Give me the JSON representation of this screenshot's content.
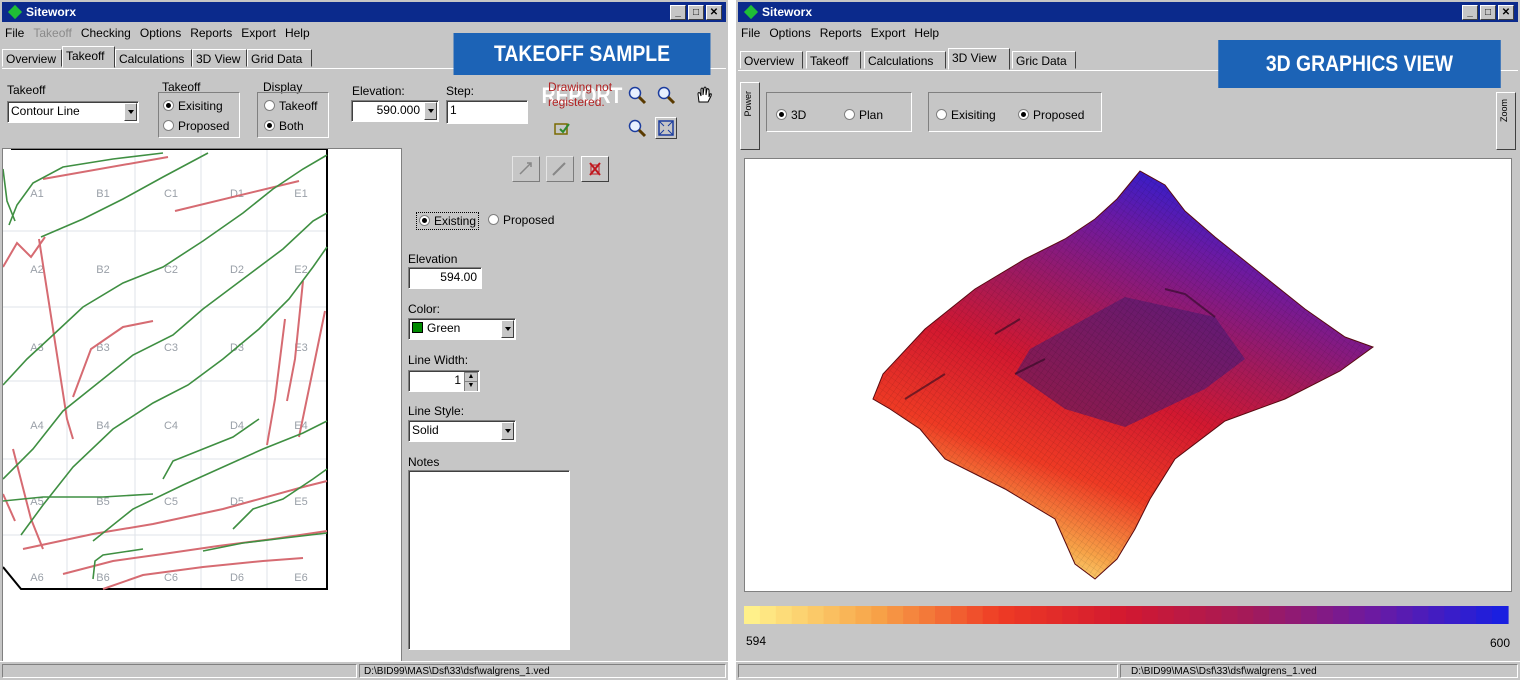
{
  "left_window": {
    "title": "Siteworx",
    "menu": [
      "File",
      "Takeoff",
      "Checking",
      "Options",
      "Reports",
      "Export",
      "Help"
    ],
    "tabs": [
      "Overview",
      "Takeoff",
      "Calculations",
      "3D View",
      "Grid Data"
    ],
    "active_tab": "Takeoff",
    "banner": "TAKEOFF SAMPLE REPORT",
    "takeoff_label": "Takeoff",
    "takeoff_select": "Contour Line",
    "takeoff_group": {
      "title": "Takeoff",
      "options": [
        "Exisiting",
        "Proposed"
      ],
      "selected": "Exisiting"
    },
    "display_group": {
      "title": "Display",
      "options": [
        "Takeoff",
        "Both"
      ],
      "selected": "Both"
    },
    "elevation_label": "Elevation:",
    "elevation_value": "590.000",
    "step_label": "Step:",
    "step_value": "1",
    "warning": [
      "Drawing not",
      "registered."
    ],
    "warning_color": "#b22222",
    "grid_cells": [
      [
        "A1",
        "B1",
        "C1",
        "D1",
        "E1"
      ],
      [
        "A2",
        "B2",
        "C2",
        "D2",
        "E2"
      ],
      [
        "A3",
        "B3",
        "C3",
        "D3",
        "E3"
      ],
      [
        "A4",
        "B4",
        "C4",
        "D4",
        "E4"
      ],
      [
        "A5",
        "B5",
        "C5",
        "D5",
        "E5"
      ],
      [
        "A6",
        "B6",
        "C6",
        "D6",
        "E6"
      ]
    ],
    "side": {
      "radio_options": [
        "Existing",
        "Proposed"
      ],
      "radio_selected": "Existing",
      "elevation_label": "Elevation",
      "elevation_value": "594.00",
      "color_label": "Color:",
      "color_value": "Green",
      "color_swatch": "#008a00",
      "line_width_label": "Line Width:",
      "line_width_value": "1",
      "line_style_label": "Line Style:",
      "line_style_value": "Solid",
      "notes_label": "Notes"
    },
    "status_path": "D:\\BID99\\MAS\\Dsf\\33\\dsf\\walgrens_1.ved"
  },
  "right_window": {
    "title": "Siteworx",
    "menu": [
      "File",
      "Options",
      "Reports",
      "Export",
      "Help"
    ],
    "tabs": [
      "Overview",
      "Takeoff",
      "Calculations",
      "3D View",
      "Gric Data"
    ],
    "active_tab": "3D View",
    "banner": "3D GRAPHICS VIEW",
    "view_group": {
      "options": [
        "3D",
        "Plan"
      ],
      "selected": "3D"
    },
    "surface_group": {
      "options": [
        "Exisiting",
        "Proposed"
      ],
      "selected": "Proposed"
    },
    "left_strip_label": "Power",
    "right_strip_label": "Zoom",
    "scale_min": "594",
    "scale_max": "600",
    "status_path": "D:\\BID99\\MAS\\Dsf\\33\\dsf\\walgrens_1.ved"
  },
  "colors": {
    "window_bg": "#c6c6c6",
    "titlebar": "#0b2a8c",
    "banner": "#1c63b6",
    "contour_existing": "#d66b72",
    "contour_proposed": "#3f8f42"
  }
}
